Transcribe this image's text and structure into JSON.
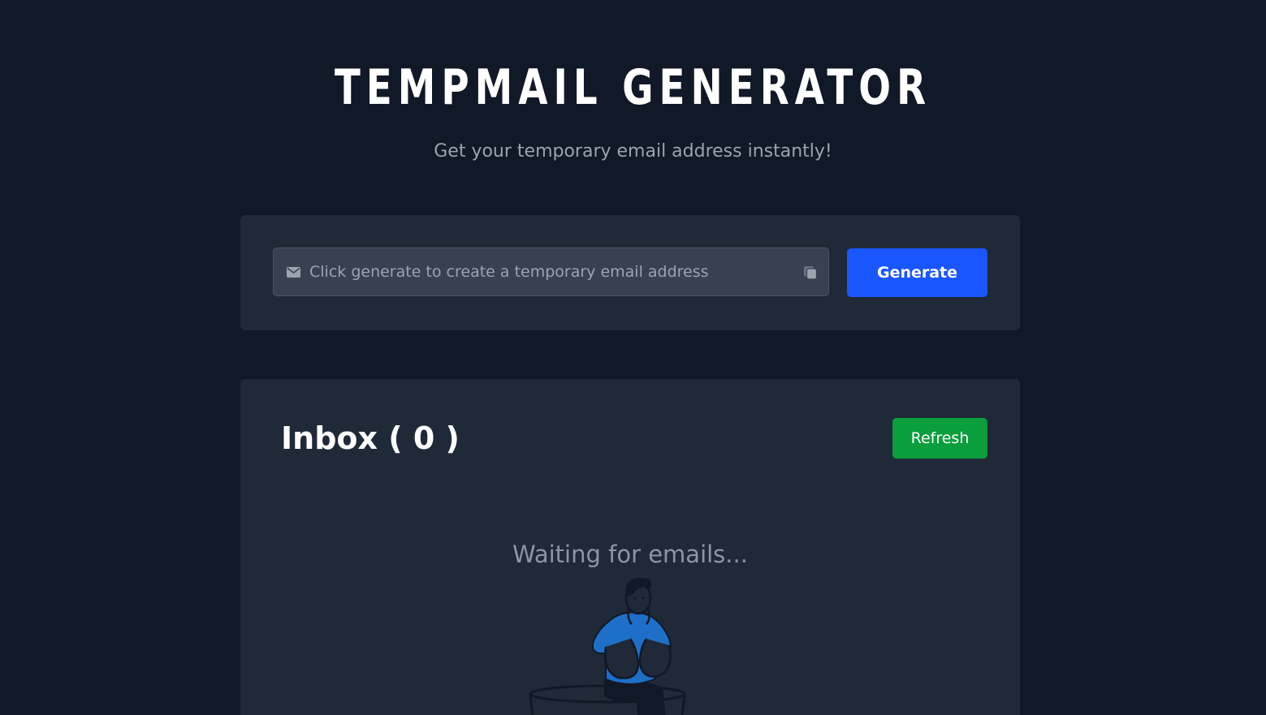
{
  "header": {
    "title": "TEMPMAIL GENERATOR",
    "subtitle": "Get your temporary email address instantly!"
  },
  "generator": {
    "email_value": "",
    "email_placeholder": "Click generate to create a temporary email address",
    "generate_label": "Generate",
    "icons": {
      "leading": "mail-icon",
      "trailing": "copy-icon"
    }
  },
  "inbox": {
    "title": "Inbox ( 0 )",
    "refresh_label": "Refresh",
    "empty_message": "Waiting for emails..."
  },
  "colors": {
    "background": "#111827",
    "card": "#1f2937",
    "input": "#374151",
    "primary": "#1a56ff",
    "success": "#0a9e3c",
    "muted_text": "#9ca3af",
    "illustration_accent": "#1e6fc7"
  }
}
